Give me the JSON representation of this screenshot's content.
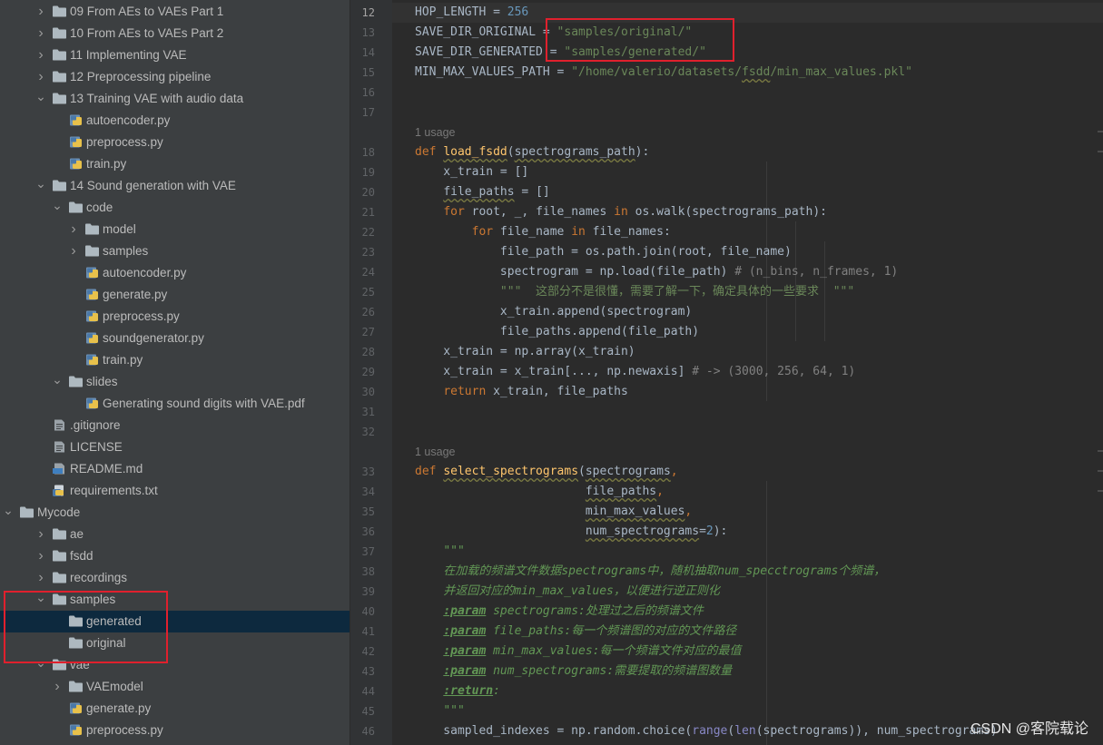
{
  "tree": {
    "rows": [
      {
        "label": "09 From AEs to VAEs Part 1",
        "type": "folder",
        "expand": "collapsed"
      },
      {
        "label": "10 From AEs to VAEs Part 2",
        "type": "folder",
        "expand": "collapsed"
      },
      {
        "label": "11 Implementing VAE",
        "type": "folder",
        "expand": "collapsed"
      },
      {
        "label": "12 Preprocessing pipeline",
        "type": "folder",
        "expand": "collapsed"
      },
      {
        "label": "13 Training VAE with audio data",
        "type": "folder",
        "expand": "expanded"
      },
      {
        "label": "autoencoder.py",
        "type": "python"
      },
      {
        "label": "preprocess.py",
        "type": "python"
      },
      {
        "label": "train.py",
        "type": "python"
      },
      {
        "label": "14 Sound generation with VAE",
        "type": "folder",
        "expand": "expanded"
      },
      {
        "label": "code",
        "type": "folder",
        "expand": "expanded"
      },
      {
        "label": "model",
        "type": "folder",
        "expand": "collapsed"
      },
      {
        "label": "samples",
        "type": "folder",
        "expand": "collapsed"
      },
      {
        "label": "autoencoder.py",
        "type": "python"
      },
      {
        "label": "generate.py",
        "type": "python"
      },
      {
        "label": "preprocess.py",
        "type": "python"
      },
      {
        "label": "soundgenerator.py",
        "type": "python"
      },
      {
        "label": "train.py",
        "type": "python"
      },
      {
        "label": "slides",
        "type": "folder",
        "expand": "expanded"
      },
      {
        "label": "Generating sound digits with VAE.pdf",
        "type": "pdf"
      },
      {
        "label": ".gitignore",
        "type": "text"
      },
      {
        "label": "LICENSE",
        "type": "text"
      },
      {
        "label": "README.md",
        "type": "markdown"
      },
      {
        "label": "requirements.txt",
        "type": "requirements"
      },
      {
        "label": "Mycode",
        "type": "folder",
        "expand": "expanded"
      },
      {
        "label": "ae",
        "type": "folder",
        "expand": "collapsed"
      },
      {
        "label": "fsdd",
        "type": "folder",
        "expand": "collapsed"
      },
      {
        "label": "recordings",
        "type": "folder",
        "expand": "collapsed"
      },
      {
        "label": "samples",
        "type": "folder",
        "expand": "expanded"
      },
      {
        "label": "generated",
        "type": "folder",
        "expand": "none",
        "selected": true
      },
      {
        "label": "original",
        "type": "folder",
        "expand": "none"
      },
      {
        "label": "vae",
        "type": "folder",
        "expand": "expanded"
      },
      {
        "label": "VAEmodel",
        "type": "folder",
        "expand": "collapsed"
      },
      {
        "label": "generate.py",
        "type": "python"
      },
      {
        "label": "preprocess.py",
        "type": "python"
      }
    ]
  },
  "editor": {
    "current_line": "12",
    "usage_label": "1 usage",
    "line_numbers": [
      "12",
      "13",
      "14",
      "15",
      "16",
      "17",
      "18",
      "19",
      "20",
      "21",
      "22",
      "23",
      "24",
      "25",
      "26",
      "27",
      "28",
      "29",
      "30",
      "31",
      "32",
      "33",
      "34",
      "35",
      "36",
      "37",
      "38",
      "39",
      "40",
      "41",
      "42",
      "43",
      "44",
      "45",
      "46"
    ],
    "code": {
      "hop_name": "HOP_LENGTH",
      "hop_eq": " = ",
      "hop_val": "256",
      "sdo_name": "SAVE_DIR_ORIGINAL",
      "sdo_eq": " = ",
      "sdo_val": "\"samples/original/\"",
      "sdg_name": "SAVE_DIR_GENERATED",
      "sdg_eq": " = ",
      "sdg_val": "\"samples/generated/\"",
      "mmv_name": "MIN_MAX_VALUES_PATH",
      "mmv_eq": " = ",
      "mmv_val_pre": "\"/home/valerio/datasets/",
      "mmv_val_fsdd": "fsdd",
      "mmv_val_post": "/min_max_values.pkl\"",
      "l18_def": "def ",
      "l18_fn": "load_fsdd",
      "l18_p1": "(",
      "l18_arg": "spectrograms_path",
      "l18_p2": "):",
      "l19": "    x_train = []",
      "l20_indent": "    ",
      "l20_var": "file_paths",
      "l20_rest": " = []",
      "l21_indent": "    ",
      "l21_for": "for",
      "l21_a": " root, _, file_names ",
      "l21_in": "in",
      "l21_b": " os.walk(spectrograms_path):",
      "l22_indent": "        ",
      "l22_for": "for",
      "l22_a": " file_name ",
      "l22_in": "in",
      "l22_b": " file_names:",
      "l23": "            file_path = os.path.join(root, file_name)",
      "l24_code": "            spectrogram = np.load(file_path)",
      "l24_sp": " ",
      "l24_cmt": "# (n_bins, n_frames, 1)",
      "l25_indent": "            ",
      "l25_doc": "\"\"\"  这部分不是很懂，需要了解一下，确定具体的一些要求  \"\"\"",
      "l26": "            x_train.append(spectrogram)",
      "l27": "            file_paths.append(file_path)",
      "l28": "    x_train = np.array(x_train)",
      "l29_code": "    x_train = x_train[..., np.newaxis]",
      "l29_sp": " ",
      "l29_cmt": "# -> (3000, 256, 64, 1)",
      "l30_indent": "    ",
      "l30_ret": "return",
      "l30_rest": " x_train, file_paths",
      "l33_def": "def ",
      "l33_fn": "select_spectrograms",
      "l33_p": "(",
      "l33_arg": "spectrograms",
      "l33_c": ",",
      "l34_indent": "                        ",
      "l34_arg": "file_paths",
      "l34_c": ",",
      "l35_indent": "                        ",
      "l35_arg": "min_max_values",
      "l35_c": ",",
      "l36_indent": "                        ",
      "l36_arg": "num_spectrograms",
      "l36_eq": "=",
      "l36_num": "2",
      "l36_end": "):",
      "l37_indent": "    ",
      "l37_doc": "\"\"\"",
      "l38_indent": "    ",
      "l38_doc": "在加载的频谱文件数据spectrograms中，随机抽取num_specctrograms个频谱，",
      "l39_indent": "    ",
      "l39_doc": "并返回对应的min_max_values，以便进行逆正则化",
      "l40_indent": "    ",
      "l40_tag": ":param",
      "l40_doc": " spectrograms:处理过之后的频谱文件",
      "l41_indent": "    ",
      "l41_tag": ":param",
      "l41_doc": " file_paths:每一个频谱图的对应的文件路径",
      "l42_indent": "    ",
      "l42_tag": ":param",
      "l42_doc": " min_max_values:每一个频谱文件对应的最值",
      "l43_indent": "    ",
      "l43_tag": ":param",
      "l43_doc": " num_spectrograms:需要提取的频谱图数量",
      "l44_indent": "    ",
      "l44_tag": ":return",
      "l44_doc": ":",
      "l45_indent": "    ",
      "l45_doc": "\"\"\"",
      "l46_a": "    sampled_indexes = np.random.choice(",
      "l46_range": "range",
      "l46_b": "(",
      "l46_len": "len",
      "l46_c": "(spectrograms)), num_spectrograms)"
    }
  },
  "watermark": "CSDN @客院载论",
  "colors": {
    "tree_bg": "#3c3f41",
    "editor_bg": "#2b2b2b",
    "gutter_bg": "#313335",
    "selection": "#0d293e",
    "keyword": "#cc7832",
    "function": "#ffc66d",
    "string": "#6a8759",
    "number": "#6897bb",
    "comment": "#808080",
    "docstring": "#629755",
    "highlight_box": "#e0202d"
  }
}
